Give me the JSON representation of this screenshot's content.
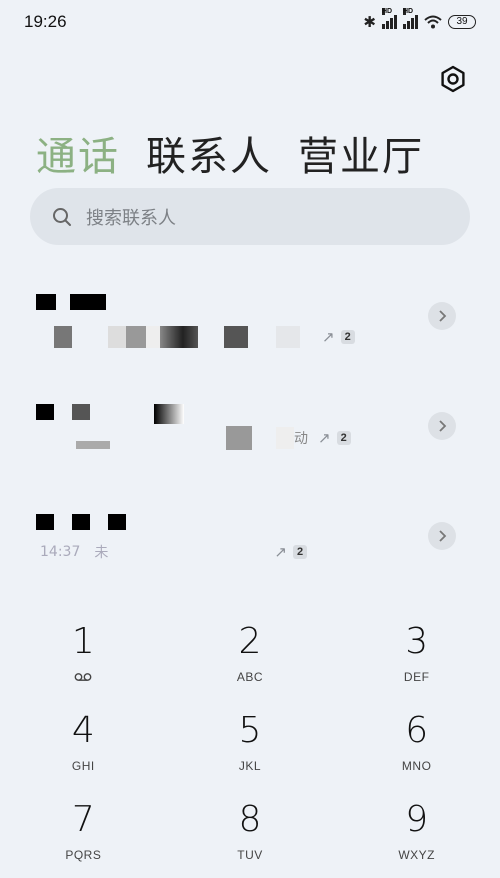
{
  "status_bar": {
    "time": "19:26",
    "sig1_label": "HD",
    "sig2_label": "HD",
    "battery": "39"
  },
  "tabs": [
    {
      "label": "通话",
      "active": true
    },
    {
      "label": "联系人",
      "active": false
    },
    {
      "label": "营业厅",
      "active": false
    }
  ],
  "search": {
    "placeholder": "搜索联系人"
  },
  "calls": [
    {
      "count": "2",
      "direction": "outgoing"
    },
    {
      "trail_text": "动",
      "count": "2",
      "direction": "outgoing"
    },
    {
      "time_text": "14:37",
      "extra_text": "未",
      "count": "2",
      "direction": "outgoing"
    }
  ],
  "keypad": [
    {
      "digit": "1",
      "letters": ""
    },
    {
      "digit": "2",
      "letters": "ABC"
    },
    {
      "digit": "3",
      "letters": "DEF"
    },
    {
      "digit": "4",
      "letters": "GHI"
    },
    {
      "digit": "5",
      "letters": "JKL"
    },
    {
      "digit": "6",
      "letters": "MNO"
    },
    {
      "digit": "7",
      "letters": "PQRS"
    },
    {
      "digit": "8",
      "letters": "TUV"
    },
    {
      "digit": "9",
      "letters": "WXYZ"
    }
  ],
  "colors": {
    "background": "#eef2f7",
    "active_tab": "#8cb183",
    "search_bg": "#dfe4ea"
  },
  "icons": [
    "bluetooth-icon",
    "signal-icon",
    "wifi-icon",
    "battery-icon",
    "settings-icon",
    "search-icon",
    "chevron-right-icon",
    "outgoing-arrow-icon",
    "voicemail-icon"
  ]
}
